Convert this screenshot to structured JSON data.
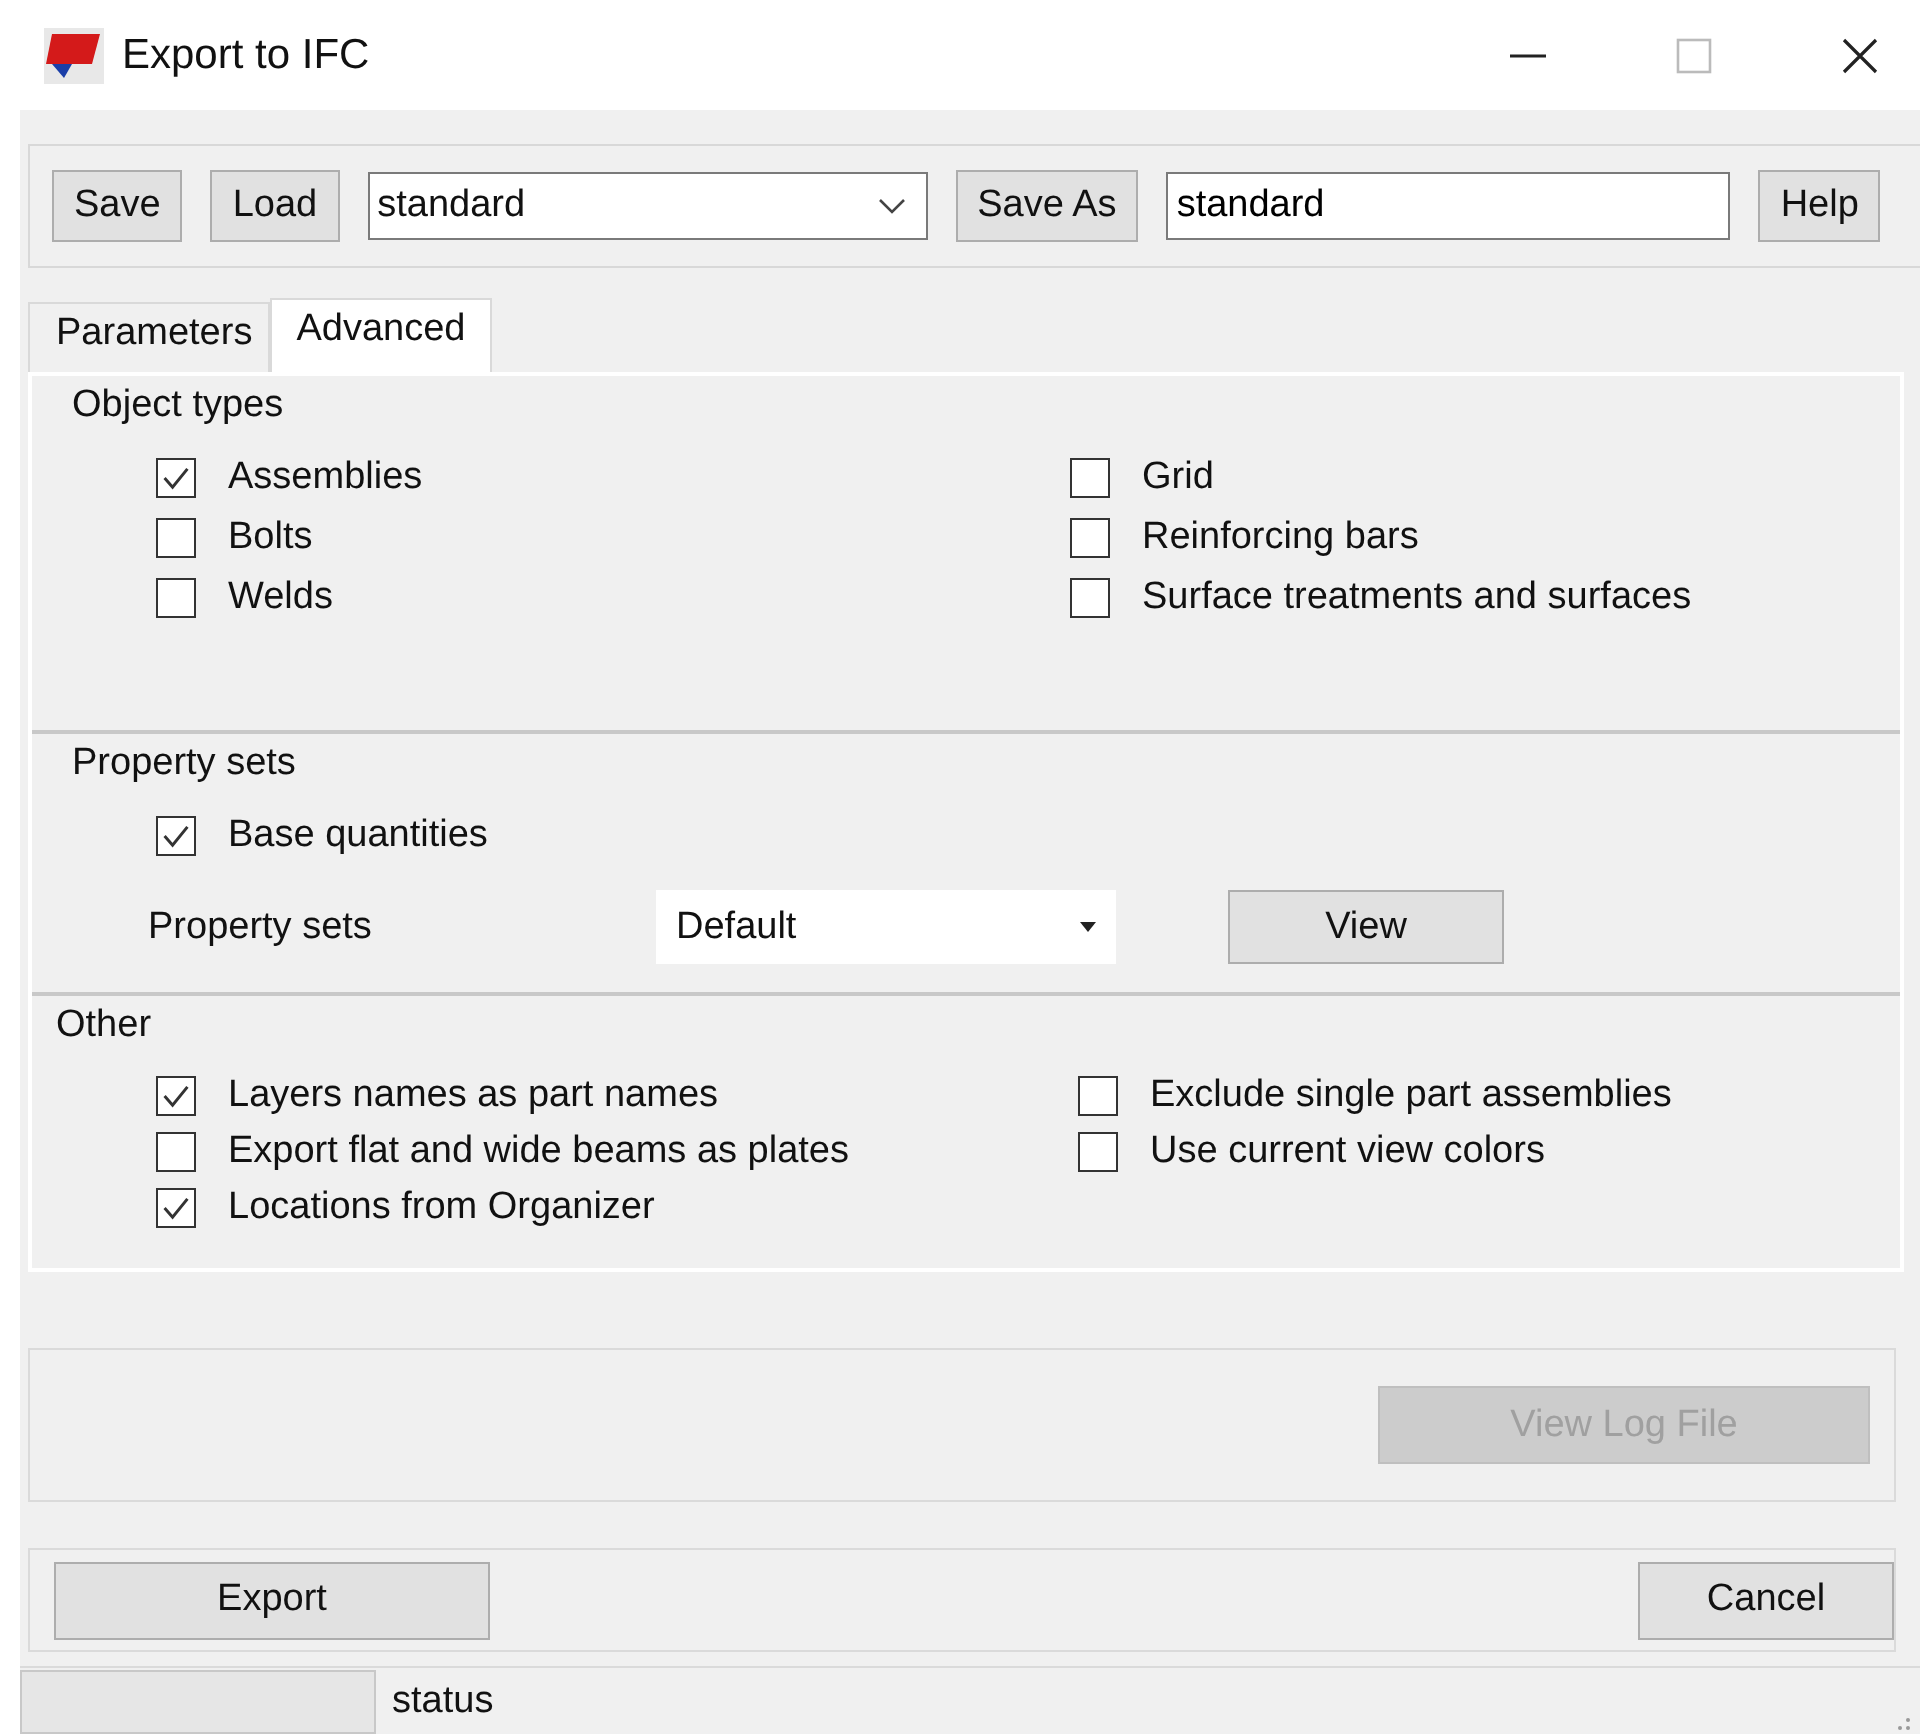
{
  "window": {
    "title": "Export to IFC"
  },
  "toolbar": {
    "save": "Save",
    "load": "Load",
    "preset": {
      "value": "standard"
    },
    "save_as": "Save As",
    "save_as_name": {
      "value": "standard"
    },
    "help": "Help"
  },
  "tabs": [
    {
      "label": "Parameters",
      "selected": false
    },
    {
      "label": "Advanced",
      "selected": true
    }
  ],
  "object_types": {
    "title": "Object types",
    "left": [
      {
        "label": "Assemblies",
        "checked": true
      },
      {
        "label": "Bolts",
        "checked": false
      },
      {
        "label": "Welds",
        "checked": false
      }
    ],
    "right": [
      {
        "label": "Grid",
        "checked": false
      },
      {
        "label": "Reinforcing bars",
        "checked": false
      },
      {
        "label": "Surface treatments and surfaces",
        "checked": false
      }
    ]
  },
  "property_sets": {
    "title": "Property sets",
    "base_quantities": {
      "label": "Base quantities",
      "checked": true
    },
    "label": "Property sets",
    "dropdown": {
      "value": "Default"
    },
    "view": "View"
  },
  "other": {
    "title": "Other",
    "left": [
      {
        "label": "Layers names as part names",
        "checked": true
      },
      {
        "label": "Export flat and wide beams as plates",
        "checked": false
      },
      {
        "label": "Locations from Organizer",
        "checked": true
      }
    ],
    "right": [
      {
        "label": "Exclude single part assemblies",
        "checked": false
      },
      {
        "label": "Use current view colors",
        "checked": false
      }
    ]
  },
  "log": {
    "button": "View Log File",
    "disabled": true
  },
  "actions": {
    "export": "Export",
    "cancel": "Cancel"
  },
  "status_bar": {
    "text": "status"
  }
}
